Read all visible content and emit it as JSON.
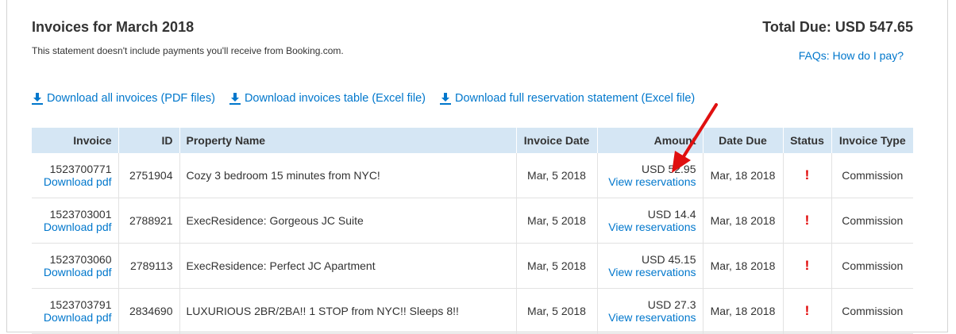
{
  "header": {
    "title": "Invoices for March 2018",
    "subtitle": "This statement doesn't include payments you'll receive from Booking.com.",
    "total_due": "Total Due: USD 547.65",
    "faq_link": "FAQs: How do I pay?"
  },
  "downloads": [
    {
      "label": "Download all invoices (PDF files)",
      "icon": "download-icon"
    },
    {
      "label": "Download invoices table (Excel file)",
      "icon": "download-icon"
    },
    {
      "label": "Download full reservation statement (Excel file)",
      "icon": "download-icon"
    }
  ],
  "table": {
    "columns": [
      "Invoice",
      "ID",
      "Property Name",
      "Invoice Date",
      "Amount",
      "Date Due",
      "Status",
      "Invoice Type"
    ],
    "rows": [
      {
        "invoice": "1523700771",
        "download": "Download pdf",
        "id": "2751904",
        "property": "Cozy 3 bedroom 15 minutes from NYC!",
        "invoice_date": "Mar, 5 2018",
        "amount": "USD 52.95",
        "view": "View reservations",
        "date_due": "Mar, 18 2018",
        "status": "!",
        "type": "Commission"
      },
      {
        "invoice": "1523703001",
        "download": "Download pdf",
        "id": "2788921",
        "property": "ExecResidence: Gorgeous JC Suite",
        "invoice_date": "Mar, 5 2018",
        "amount": "USD 14.4",
        "view": "View reservations",
        "date_due": "Mar, 18 2018",
        "status": "!",
        "type": "Commission"
      },
      {
        "invoice": "1523703060",
        "download": "Download pdf",
        "id": "2789113",
        "property": "ExecResidence: Perfect JC Apartment",
        "invoice_date": "Mar, 5 2018",
        "amount": "USD 45.15",
        "view": "View reservations",
        "date_due": "Mar, 18 2018",
        "status": "!",
        "type": "Commission"
      },
      {
        "invoice": "1523703791",
        "download": "Download pdf",
        "id": "2834690",
        "property": "LUXURIOUS 2BR/2BA!! 1 STOP from NYC!! Sleeps 8!!",
        "invoice_date": "Mar, 5 2018",
        "amount": "USD 27.3",
        "view": "View reservations",
        "date_due": "Mar, 18 2018",
        "status": "!",
        "type": "Commission"
      }
    ]
  },
  "colors": {
    "link": "#0077cc",
    "header_bg": "#d5e6f4",
    "status_alert": "#e00000",
    "annotation_arrow": "#e01010"
  }
}
